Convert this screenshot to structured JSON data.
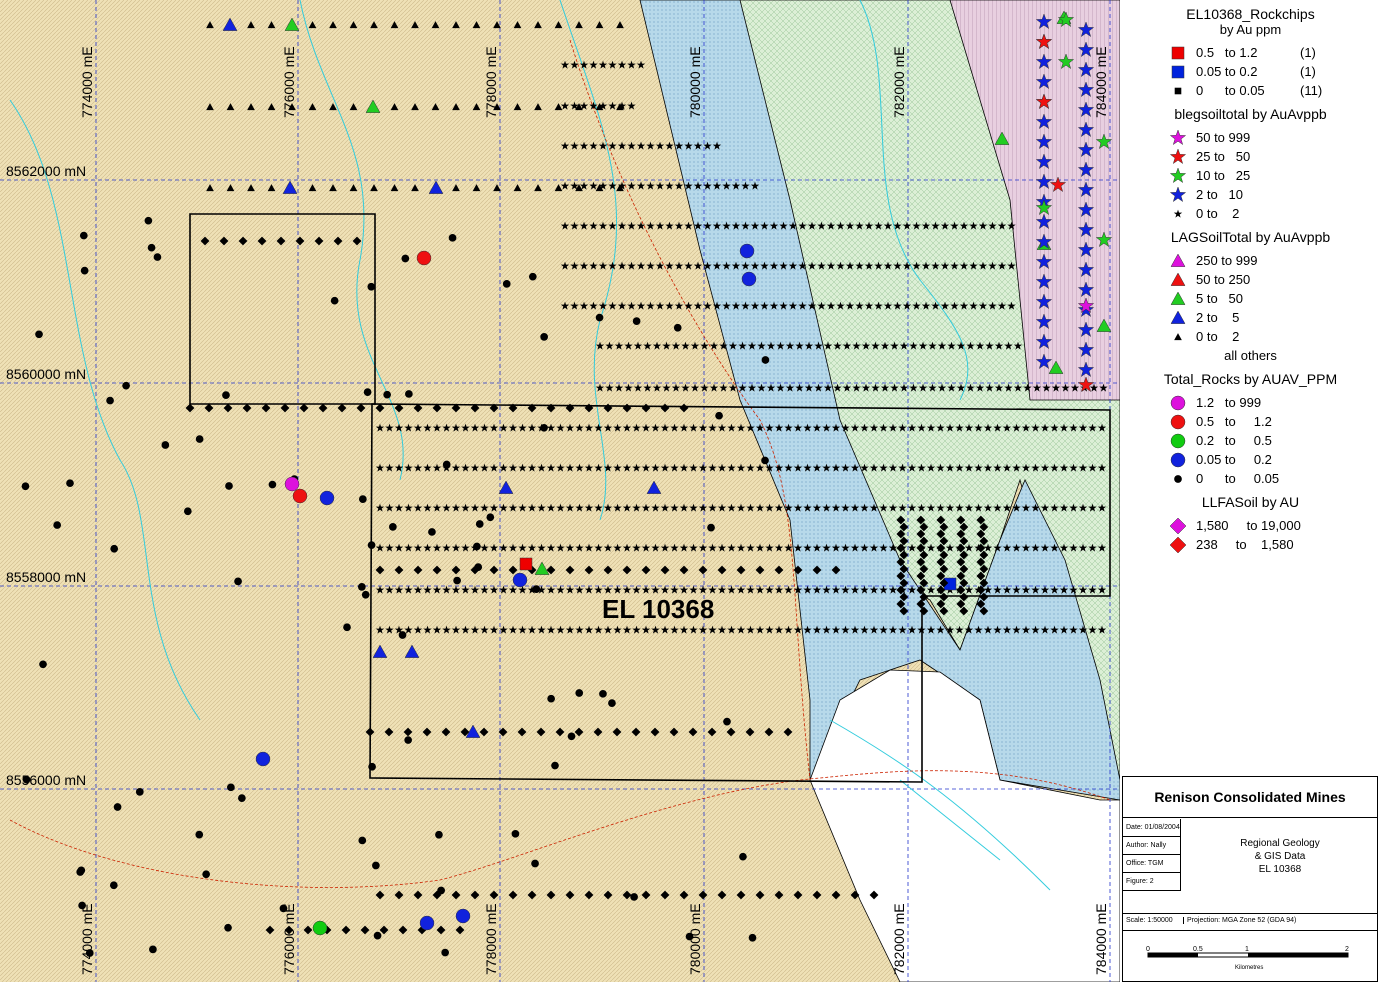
{
  "map": {
    "label": "EL 10368",
    "easting_labels": [
      "774000 mE",
      "776000 mE",
      "778000 mE",
      "780000 mE",
      "782000 mE",
      "784000 mE"
    ],
    "northing_labels": [
      "8562000 mN",
      "8560000 mN",
      "8558000 mN",
      "8556000 mN"
    ],
    "colors": {
      "background": "#efe1b6",
      "blue_zone": "#b7d9ea",
      "green_zone": "#dcefd6",
      "pink_zone": "#e8cfe0",
      "grid": "#2233cc",
      "streams": "#33ccdd",
      "road": "#cc2200"
    }
  },
  "legend": {
    "sections": [
      {
        "title": "EL10368_Rockchips",
        "subtitle": "by Au ppm",
        "rows": [
          {
            "symbol": "square",
            "color": "#ee0000",
            "label": "0.5   to 1.2",
            "count": "(1)"
          },
          {
            "symbol": "square",
            "color": "#0022dd",
            "label": "0.05 to 0.2",
            "count": "(1)"
          },
          {
            "symbol": "square-small",
            "color": "#000000",
            "label": "0      to 0.05",
            "count": "(11)"
          }
        ]
      },
      {
        "title": "blegsoiltotal by AuAvppb",
        "rows": [
          {
            "symbol": "star",
            "color": "#dd11dd",
            "label": "50 to 999"
          },
          {
            "symbol": "star",
            "color": "#ee1111",
            "label": "25 to   50"
          },
          {
            "symbol": "star",
            "color": "#22cc22",
            "label": "10 to   25"
          },
          {
            "symbol": "star",
            "color": "#1122dd",
            "label": "2 to   10"
          },
          {
            "symbol": "star-small",
            "color": "#000000",
            "label": "0 to    2"
          }
        ]
      },
      {
        "title": "LAGSoilTotal by AuAvppb",
        "rows": [
          {
            "symbol": "triangle",
            "color": "#dd11dd",
            "label": "250 to 999"
          },
          {
            "symbol": "triangle",
            "color": "#ee1111",
            "label": "50 to 250"
          },
          {
            "symbol": "triangle",
            "color": "#22cc22",
            "label": "5 to   50"
          },
          {
            "symbol": "triangle",
            "color": "#1122dd",
            "label": "2 to    5"
          },
          {
            "symbol": "triangle-small",
            "color": "#000000",
            "label": "0 to    2"
          }
        ],
        "note": "all others"
      },
      {
        "title": "Total_Rocks by AUAV_PPM",
        "rows": [
          {
            "symbol": "circle",
            "color": "#dd11dd",
            "label": "1.2   to 999"
          },
          {
            "symbol": "circle",
            "color": "#ee1111",
            "label": "0.5   to     1.2"
          },
          {
            "symbol": "circle",
            "color": "#11cc11",
            "label": "0.2   to     0.5"
          },
          {
            "symbol": "circle",
            "color": "#1122dd",
            "label": "0.05 to     0.2"
          },
          {
            "symbol": "circle-small",
            "color": "#000000",
            "label": "0      to     0.05"
          }
        ]
      },
      {
        "title": "LLFASoil by AU",
        "rows": [
          {
            "symbol": "diamond",
            "color": "#dd11dd",
            "label": "1,580     to 19,000"
          },
          {
            "symbol": "diamond",
            "color": "#ee1111",
            "label": "238     to    1,580"
          }
        ]
      }
    ]
  },
  "titleblock": {
    "company": "Renison Consolidated Mines",
    "date": "Date: 01/08/2004",
    "author": "Author: Nally",
    "office": "Office: TGM",
    "figure": "Figure: 2",
    "scale": "Scale: 1:50000",
    "projection": "Projection: MGA Zone 52 (GDA 94)",
    "title_line1": "Regional Geology",
    "title_line2": "& GIS Data",
    "title_line3": "EL 10368",
    "scale_ticks": [
      "0",
      "0.5",
      "1",
      "2"
    ],
    "scale_unit": "Kilometres"
  }
}
